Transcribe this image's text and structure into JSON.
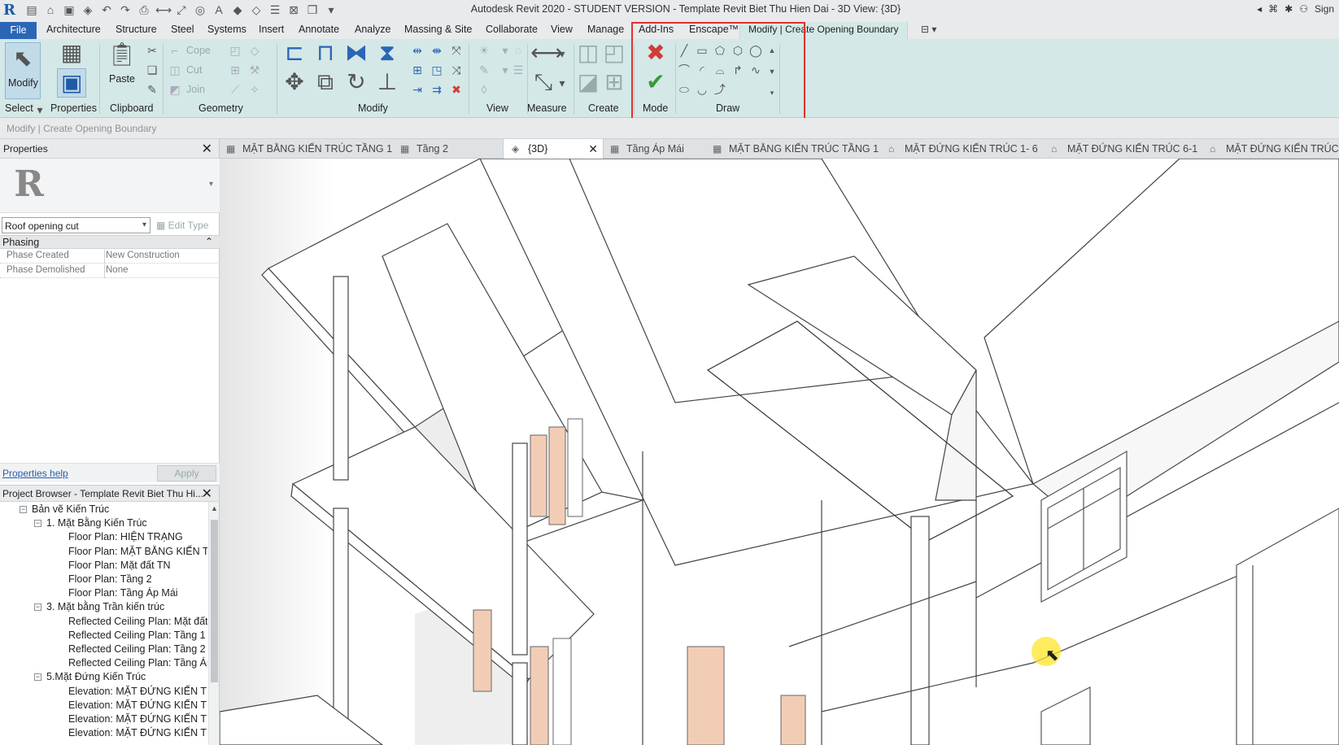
{
  "titlebar": {
    "title": "Autodesk Revit 2020 - STUDENT VERSION - Template Revit Biet Thu Hien Dai - 3D View: {3D}",
    "sign_in": "Sign"
  },
  "menu": {
    "file": "File",
    "tabs": [
      "Architecture",
      "Structure",
      "Steel",
      "Systems",
      "Insert",
      "Annotate",
      "Analyze",
      "Massing & Site",
      "Collaborate",
      "View",
      "Manage",
      "Add-Ins",
      "Enscape™"
    ],
    "active_tab": "Modify | Create Opening Boundary"
  },
  "ribbon": {
    "select": {
      "modify_label": "Modify",
      "group": "Select"
    },
    "properties": {
      "label": "Properties"
    },
    "clipboard": {
      "paste_label": "Paste",
      "group": "Clipboard"
    },
    "geometry": {
      "cope": "Cope",
      "cut": "Cut",
      "join": "Join",
      "group": "Geometry"
    },
    "modify": {
      "group": "Modify"
    },
    "view": {
      "group": "View"
    },
    "measure": {
      "group": "Measure"
    },
    "create": {
      "group": "Create"
    },
    "mode": {
      "group": "Mode"
    },
    "draw": {
      "group": "Draw"
    }
  },
  "options_bar": {
    "text": "Modify | Create Opening Boundary"
  },
  "view_tabs": [
    {
      "label": "MẶT BẰNG KIẾN TRÚC TẦNG 1",
      "icon": "floorplan-icon"
    },
    {
      "label": "Tầng 2",
      "icon": "floorplan-icon"
    },
    {
      "label": "{3D}",
      "icon": "3d-view-icon",
      "active": true
    },
    {
      "label": "Tầng Áp Mái",
      "icon": "floorplan-icon"
    },
    {
      "label": "MẶT BẰNG KIẾN TRÚC TẦNG 1",
      "icon": "floorplan-icon"
    },
    {
      "label": "MẶT ĐỨNG KIẾN TRÚC 1- 6",
      "icon": "elevation-icon"
    },
    {
      "label": "MẶT ĐỨNG KIẾN TRÚC 6-1",
      "icon": "elevation-icon"
    },
    {
      "label": "MẶT ĐỨNG KIẾN TRÚC A",
      "icon": "elevation-icon"
    }
  ],
  "properties": {
    "title": "Properties",
    "type_selector": "Roof opening cut",
    "edit_type": "Edit Type",
    "section": "Phasing",
    "rows": [
      {
        "key": "Phase Created",
        "value": "New Construction"
      },
      {
        "key": "Phase Demolished",
        "value": "None"
      }
    ],
    "help_link": "Properties help",
    "apply": "Apply"
  },
  "browser": {
    "title": "Project Browser - Template Revit Biet Thu Hi...",
    "nodes": [
      {
        "label": "Bản vẽ Kiến Trúc",
        "level": 0,
        "expander": "−"
      },
      {
        "label": "1. Mặt Bằng Kiến Trúc",
        "level": 1,
        "expander": "−"
      },
      {
        "label": "Floor Plan: HIỆN TRẠNG",
        "level": 2
      },
      {
        "label": "Floor Plan: MẶT BẰNG KIẾN TRÚ",
        "level": 2
      },
      {
        "label": "Floor Plan: Mặt đất TN",
        "level": 2
      },
      {
        "label": "Floor Plan: Tầng 2",
        "level": 2
      },
      {
        "label": "Floor Plan: Tầng Áp Mái",
        "level": 2
      },
      {
        "label": "3. Mặt bằng Trần kiến trúc",
        "level": 1,
        "expander": "−"
      },
      {
        "label": "Reflected Ceiling Plan: Mặt đất",
        "level": 2
      },
      {
        "label": "Reflected Ceiling Plan: Tầng 1",
        "level": 2
      },
      {
        "label": "Reflected Ceiling Plan: Tầng 2",
        "level": 2
      },
      {
        "label": "Reflected Ceiling Plan: Tầng Áp",
        "level": 2
      },
      {
        "label": "5.Mặt Đứng Kiến Trúc",
        "level": 1,
        "expander": "−"
      },
      {
        "label": "Elevation: MẶT ĐỨNG KIẾN TRÚ",
        "level": 2
      },
      {
        "label": "Elevation: MẶT ĐỨNG KIẾN TRÚ",
        "level": 2
      },
      {
        "label": "Elevation: MẶT ĐỨNG KIẾN TRÚ",
        "level": 2
      },
      {
        "label": "Elevation: MẶT ĐỨNG KIẾN TRÚ",
        "level": 2
      }
    ]
  },
  "colors": {
    "ribbon_bg": "#d4e8e7",
    "file_tab": "#2b66b6",
    "highlight": "#e0302e",
    "finish_check": "#3a9a3a",
    "cancel_x": "#d23b3b",
    "door_fill": "#f2cdb6"
  }
}
